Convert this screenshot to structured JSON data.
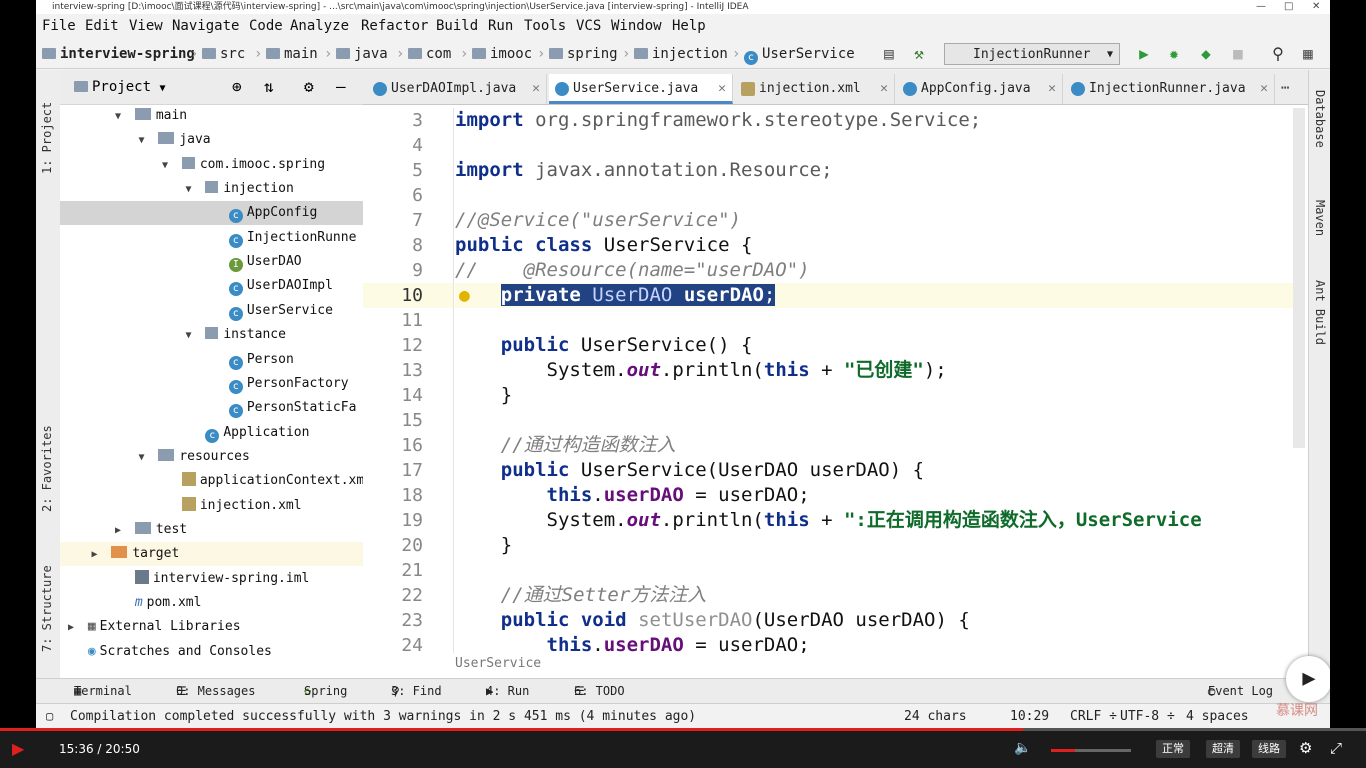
{
  "window": {
    "title": "interview-spring [D:\\imooc\\面试课程\\源代码\\interview-spring] - ...\\src\\main\\java\\com\\imooc\\spring\\injection\\UserService.java [interview-spring] - IntelliJ IDEA"
  },
  "menu": [
    "File",
    "Edit",
    "View",
    "Navigate",
    "Code",
    "Analyze",
    "Refactor",
    "Build",
    "Run",
    "Tools",
    "VCS",
    "Window",
    "Help"
  ],
  "nav": {
    "crumbs": [
      "interview-spring",
      "src",
      "main",
      "java",
      "com",
      "imooc",
      "spring",
      "injection",
      "UserService"
    ],
    "run_config": "InjectionRunner"
  },
  "project": {
    "header": "Project",
    "tree": [
      {
        "label": "main",
        "type": "folder",
        "depth": 2,
        "expanded": true
      },
      {
        "label": "java",
        "type": "folder",
        "depth": 3,
        "expanded": true
      },
      {
        "label": "com.imooc.spring",
        "type": "package",
        "depth": 4,
        "expanded": true
      },
      {
        "label": "injection",
        "type": "package",
        "depth": 5,
        "expanded": true
      },
      {
        "label": "AppConfig",
        "type": "class",
        "depth": 6,
        "selected": true
      },
      {
        "label": "InjectionRunne",
        "type": "class",
        "depth": 6
      },
      {
        "label": "UserDAO",
        "type": "interface",
        "depth": 6
      },
      {
        "label": "UserDAOImpl",
        "type": "class",
        "depth": 6
      },
      {
        "label": "UserService",
        "type": "class",
        "depth": 6
      },
      {
        "label": "instance",
        "type": "package",
        "depth": 5,
        "expanded": true
      },
      {
        "label": "Person",
        "type": "class",
        "depth": 6
      },
      {
        "label": "PersonFactory",
        "type": "class",
        "depth": 6
      },
      {
        "label": "PersonStaticFa",
        "type": "class",
        "depth": 6
      },
      {
        "label": "Application",
        "type": "class",
        "depth": 5
      },
      {
        "label": "resources",
        "type": "folder",
        "depth": 3,
        "expanded": true
      },
      {
        "label": "applicationContext.xml",
        "type": "xml",
        "depth": 4
      },
      {
        "label": "injection.xml",
        "type": "xml",
        "depth": 4
      },
      {
        "label": "test",
        "type": "folder",
        "depth": 2,
        "expanded": false
      },
      {
        "label": "target",
        "type": "folder-orange",
        "depth": 1,
        "expanded": false,
        "highlight": true
      },
      {
        "label": "interview-spring.iml",
        "type": "file",
        "depth": 2
      },
      {
        "label": "pom.xml",
        "type": "maven",
        "depth": 2
      },
      {
        "label": "External Libraries",
        "type": "lib",
        "depth": 0,
        "expanded": false
      },
      {
        "label": "Scratches and Consoles",
        "type": "scratch",
        "depth": 0
      }
    ]
  },
  "tabs": [
    {
      "label": "UserDAOImpl.java",
      "kind": "class"
    },
    {
      "label": "UserService.java",
      "kind": "class",
      "active": true
    },
    {
      "label": "injection.xml",
      "kind": "xml"
    },
    {
      "label": "AppConfig.java",
      "kind": "class"
    },
    {
      "label": "InjectionRunner.java",
      "kind": "class"
    }
  ],
  "code": {
    "line_numbers": [
      "3",
      "4",
      "5",
      "6",
      "7",
      "8",
      "9",
      "10",
      "11",
      "12",
      "13",
      "14",
      "15",
      "16",
      "17",
      "18",
      "19",
      "20",
      "21",
      "22",
      "23",
      "24"
    ],
    "current_line": "10",
    "breadcrumb": "UserService"
  },
  "left_strip": [
    "1: Project",
    "2: Favorites",
    "7: Structure"
  ],
  "right_strip": [
    "Database",
    "Maven",
    "Ant Build"
  ],
  "bottom_tools": [
    {
      "label": "Terminal",
      "icon": "terminal-icon"
    },
    {
      "label": "0: Messages",
      "icon": "messages-icon"
    },
    {
      "label": "Spring",
      "icon": "spring-icon"
    },
    {
      "label": "3: Find",
      "icon": "find-icon"
    },
    {
      "label": "4: Run",
      "icon": "run-icon"
    },
    {
      "label": "6: TODO",
      "icon": "todo-icon"
    },
    {
      "label": "Event Log",
      "icon": "event-log-icon"
    }
  ],
  "status": {
    "message": "Compilation completed successfully with 3 warnings in 2 s 451 ms (4 minutes ago)",
    "chars": "24 chars",
    "position": "10:29",
    "line_sep": "CRLF ÷",
    "encoding": "UTF-8 ÷",
    "indent": "4 spaces"
  },
  "player": {
    "time": "15:36 / 20:50",
    "progress_fraction": 0.749,
    "volume_fraction": 0.3,
    "quality_buttons": [
      "正常",
      "超清",
      "线路"
    ],
    "watermark": "慕课网"
  }
}
